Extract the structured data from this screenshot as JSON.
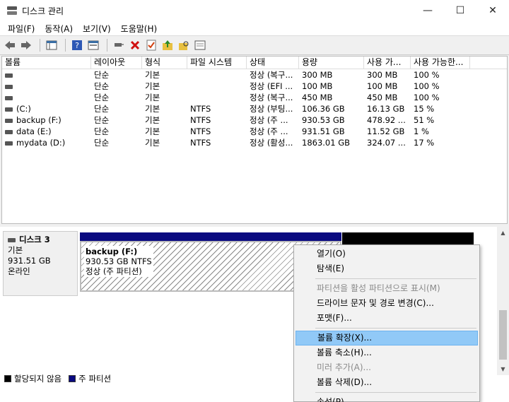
{
  "window": {
    "title": "디스크 관리",
    "minimize": "—",
    "maximize": "☐",
    "close": "✕"
  },
  "menu": [
    "파일(F)",
    "동작(A)",
    "보기(V)",
    "도움말(H)"
  ],
  "toolbar": {
    "icons": [
      "back-arrow-icon",
      "forward-arrow-icon",
      "console-tree-icon",
      "help-icon",
      "properties-icon",
      "connect-icon",
      "delete-icon",
      "check-icon",
      "folder-up-icon",
      "folder-search-icon",
      "list-icon"
    ]
  },
  "volume_table": {
    "columns": [
      "볼륨",
      "레이아웃",
      "형식",
      "파일 시스템",
      "상태",
      "용량",
      "사용 가...",
      "사용 가능한..."
    ],
    "rows": [
      [
        "",
        "단순",
        "기본",
        "",
        "정상 (복구...",
        "300 MB",
        "300 MB",
        "100 %"
      ],
      [
        "",
        "단순",
        "기본",
        "",
        "정상 (EFI ...",
        "100 MB",
        "100 MB",
        "100 %"
      ],
      [
        "",
        "단순",
        "기본",
        "",
        "정상 (복구...",
        "450 MB",
        "450 MB",
        "100 %"
      ],
      [
        "(C:)",
        "단순",
        "기본",
        "NTFS",
        "정상 (부팅...",
        "106.36 GB",
        "16.13 GB",
        "15 %"
      ],
      [
        "backup (F:)",
        "단순",
        "기본",
        "NTFS",
        "정상 (주 ...",
        "930.53 GB",
        "478.92 ...",
        "51 %"
      ],
      [
        "data (E:)",
        "단순",
        "기본",
        "NTFS",
        "정상 (주 ...",
        "931.51 GB",
        "11.52 GB",
        "1 %"
      ],
      [
        "mydata (D:)",
        "단순",
        "기본",
        "NTFS",
        "정상 (활성...",
        "1863.01 GB",
        "324.07 ...",
        "17 %"
      ]
    ]
  },
  "disk": {
    "name": "디스크 3",
    "type": "기본",
    "size": "931.51 GB",
    "status": "온라인",
    "partition": {
      "name": "backup  (F:)",
      "size_fs": "930.53 GB NTFS",
      "status": "정상 (주 파티션)"
    }
  },
  "legend": {
    "unallocated": "할당되지 않음",
    "primary": "주 파티션",
    "unallocated_color": "#000000",
    "primary_color": "#0a0a80"
  },
  "context_menu": {
    "items": [
      {
        "label": "열기(O)",
        "enabled": true
      },
      {
        "label": "탐색(E)",
        "enabled": true
      },
      {
        "label": "파티션을 활성 파티션으로 표시(M)",
        "enabled": false
      },
      {
        "label": "드라이브 문자 및 경로 변경(C)...",
        "enabled": true
      },
      {
        "label": "포맷(F)...",
        "enabled": true
      },
      {
        "label": "볼륨 확장(X)...",
        "enabled": true,
        "highlighted": true
      },
      {
        "label": "볼륨 축소(H)...",
        "enabled": true
      },
      {
        "label": "미러 추가(A)...",
        "enabled": false
      },
      {
        "label": "볼륨 삭제(D)...",
        "enabled": true
      },
      {
        "label": "속성(P)",
        "enabled": true
      }
    ]
  }
}
